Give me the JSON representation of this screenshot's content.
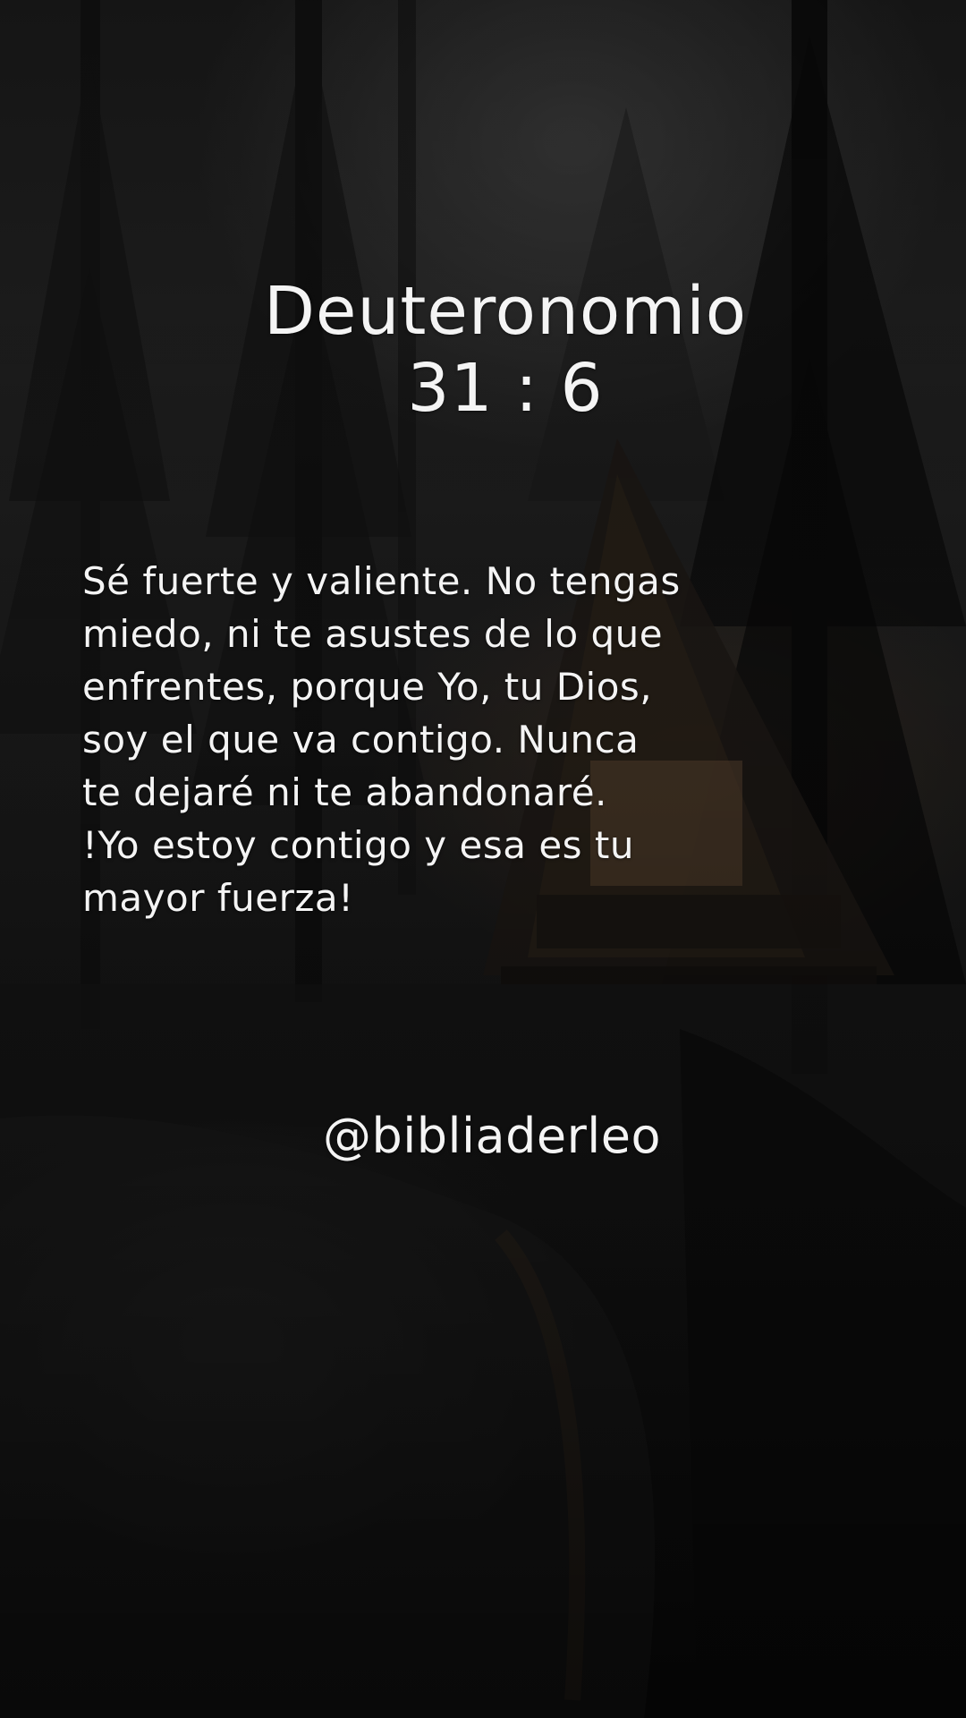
{
  "reference": {
    "book": "Deuteronomio",
    "chapter_verse": "31 : 6"
  },
  "verse_lines": [
    "Sé fuerte y valiente. No tengas",
    "miedo, ni te asustes de lo que",
    "enfrentes, porque Yo, tu Dios,",
    "soy el que va contigo. Nunca",
    "te dejaré ni te abandonaré.",
    "!Yo estoy contigo y esa es tu",
    "mayor fuerza!"
  ],
  "handle": "@bibliaderleo",
  "colors": {
    "text": "#f4f4f4",
    "background": "#1a1a1a",
    "cabin_glow": "#46341f"
  }
}
